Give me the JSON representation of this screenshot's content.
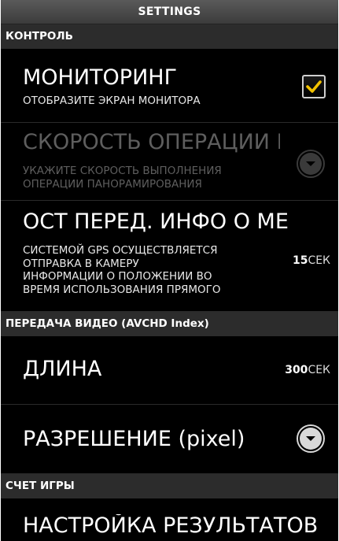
{
  "header": {
    "title": "SETTINGS"
  },
  "sections": {
    "control": {
      "label": "КОНТРОЛЬ",
      "monitoring": {
        "title": "МОНИТОРИНГ",
        "desc": "ОТОБРАЗИТЕ ЭКРАН МОНИТОРА",
        "checked": true,
        "icon": "checkmark-icon"
      },
      "operation_speed": {
        "title": "СКОРОСТЬ ОПЕРАЦИИ П",
        "desc": [
          "УКАЖИТЕ СКОРОСТЬ ВЫПОЛНЕНИЯ",
          "ОПЕРАЦИИ ПАНОРАМИРОВАНИЯ"
        ],
        "enabled": false,
        "icon": "chevron-down-icon"
      },
      "gps_info": {
        "title": "ОСТ ПЕРЕД. ИНФО О МЕ",
        "desc": [
          "СИСТЕМОЙ GPS ОСУЩЕСТВЛЯЕТСЯ",
          "ОТПРАВКА В КАМЕРУ",
          "ИНФОРМАЦИИ О ПОЛОЖЕНИИ ВО",
          "ВРЕМЯ ИСПОЛЬЗОВАНИЯ ПРЯМОГО"
        ],
        "value": "15",
        "unit": "СЕК"
      }
    },
    "video": {
      "label": "ПЕРЕДАЧА ВИДЕО (AVCHD Index)",
      "length": {
        "title": "ДЛИНА",
        "value": "300",
        "unit": "СЕК"
      },
      "resolution": {
        "title": "РАЗРЕШЕНИЕ (pixel)",
        "icon": "chevron-down-icon"
      }
    },
    "score": {
      "label": "СЧЕТ ИГРЫ",
      "setup": {
        "title": "НАСТРОЙКА РЕЗУЛЬТАТОВ"
      }
    }
  },
  "colors": {
    "background": "#000000",
    "section_header": "#2c2c2c",
    "checkmark": "#f2c200",
    "disabled_text": "#5e5e5e"
  }
}
